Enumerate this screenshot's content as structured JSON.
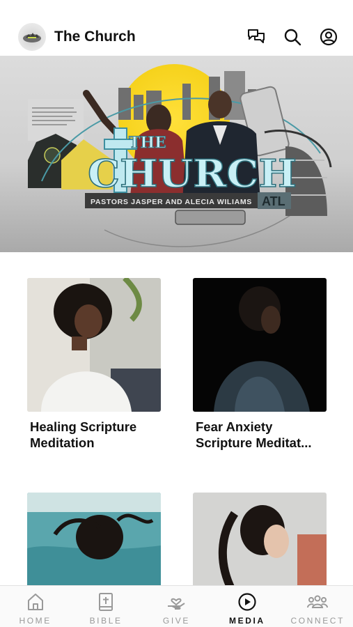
{
  "header": {
    "title": "The Church",
    "icons": [
      "church-logo-icon",
      "chat-icon",
      "search-icon",
      "account-icon"
    ]
  },
  "hero": {
    "logo_line1": "THE",
    "logo_line2": "CHURCH",
    "subtitle": "PASTORS JASPER AND ALECIA WILIAMS",
    "badge": "ATL",
    "accent_color": "#7fd0e0"
  },
  "cards": [
    {
      "title_line1": "Healing Scripture",
      "title_line2": "Meditation"
    },
    {
      "title_line1": "Fear Anxiety",
      "title_line2": "Scripture Meditat..."
    },
    {
      "title_line1": "",
      "title_line2": ""
    },
    {
      "title_line1": "",
      "title_line2": ""
    }
  ],
  "tabs": [
    {
      "label": "HOME",
      "icon": "home-icon",
      "active": false
    },
    {
      "label": "BIBLE",
      "icon": "bible-icon",
      "active": false
    },
    {
      "label": "GIVE",
      "icon": "give-icon",
      "active": false
    },
    {
      "label": "MEDIA",
      "icon": "play-icon",
      "active": true
    },
    {
      "label": "CONNECT",
      "icon": "people-icon",
      "active": false
    }
  ]
}
